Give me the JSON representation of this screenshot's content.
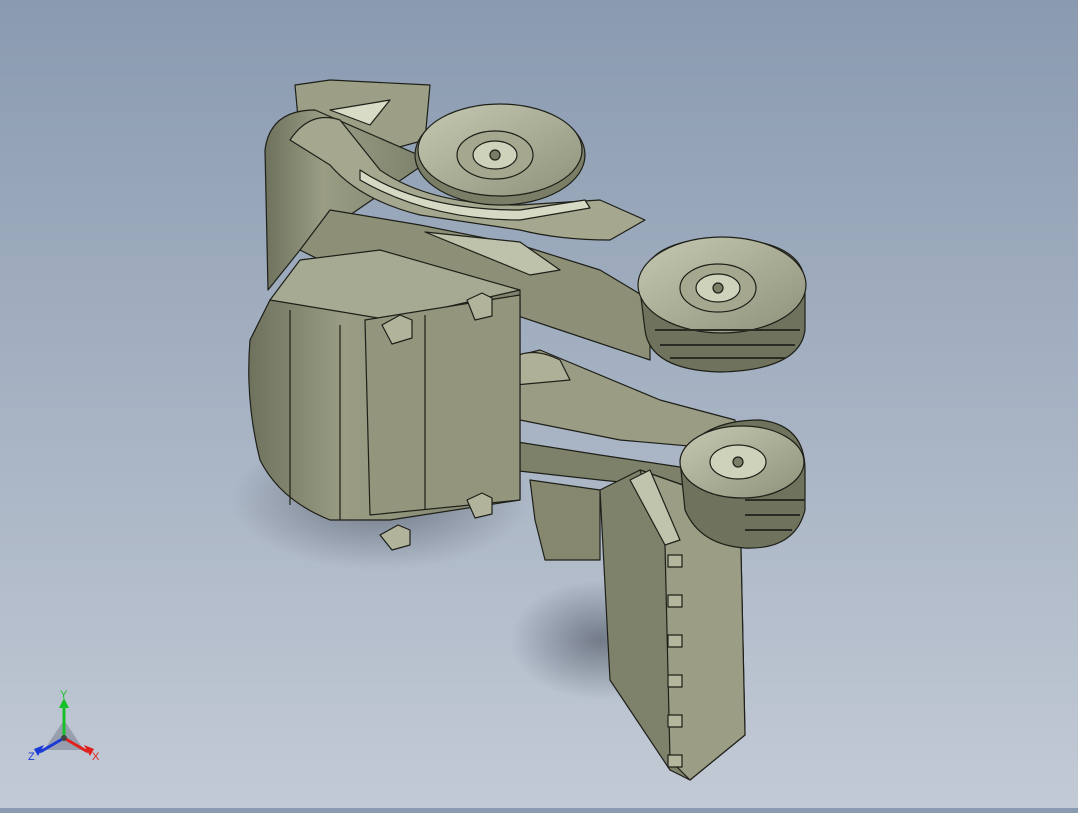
{
  "viewport": {
    "background_top": "#8a9ab0",
    "background_bottom": "#c2cad5",
    "model_color": "#8c8f76",
    "model_shadow": "#5f6250",
    "model_highlight": "#b7baa1"
  },
  "triad": {
    "x_label": "X",
    "y_label": "Y",
    "z_label": "Z",
    "x_color": "#e0201a",
    "y_color": "#18c028",
    "z_color": "#1a3ad8"
  }
}
